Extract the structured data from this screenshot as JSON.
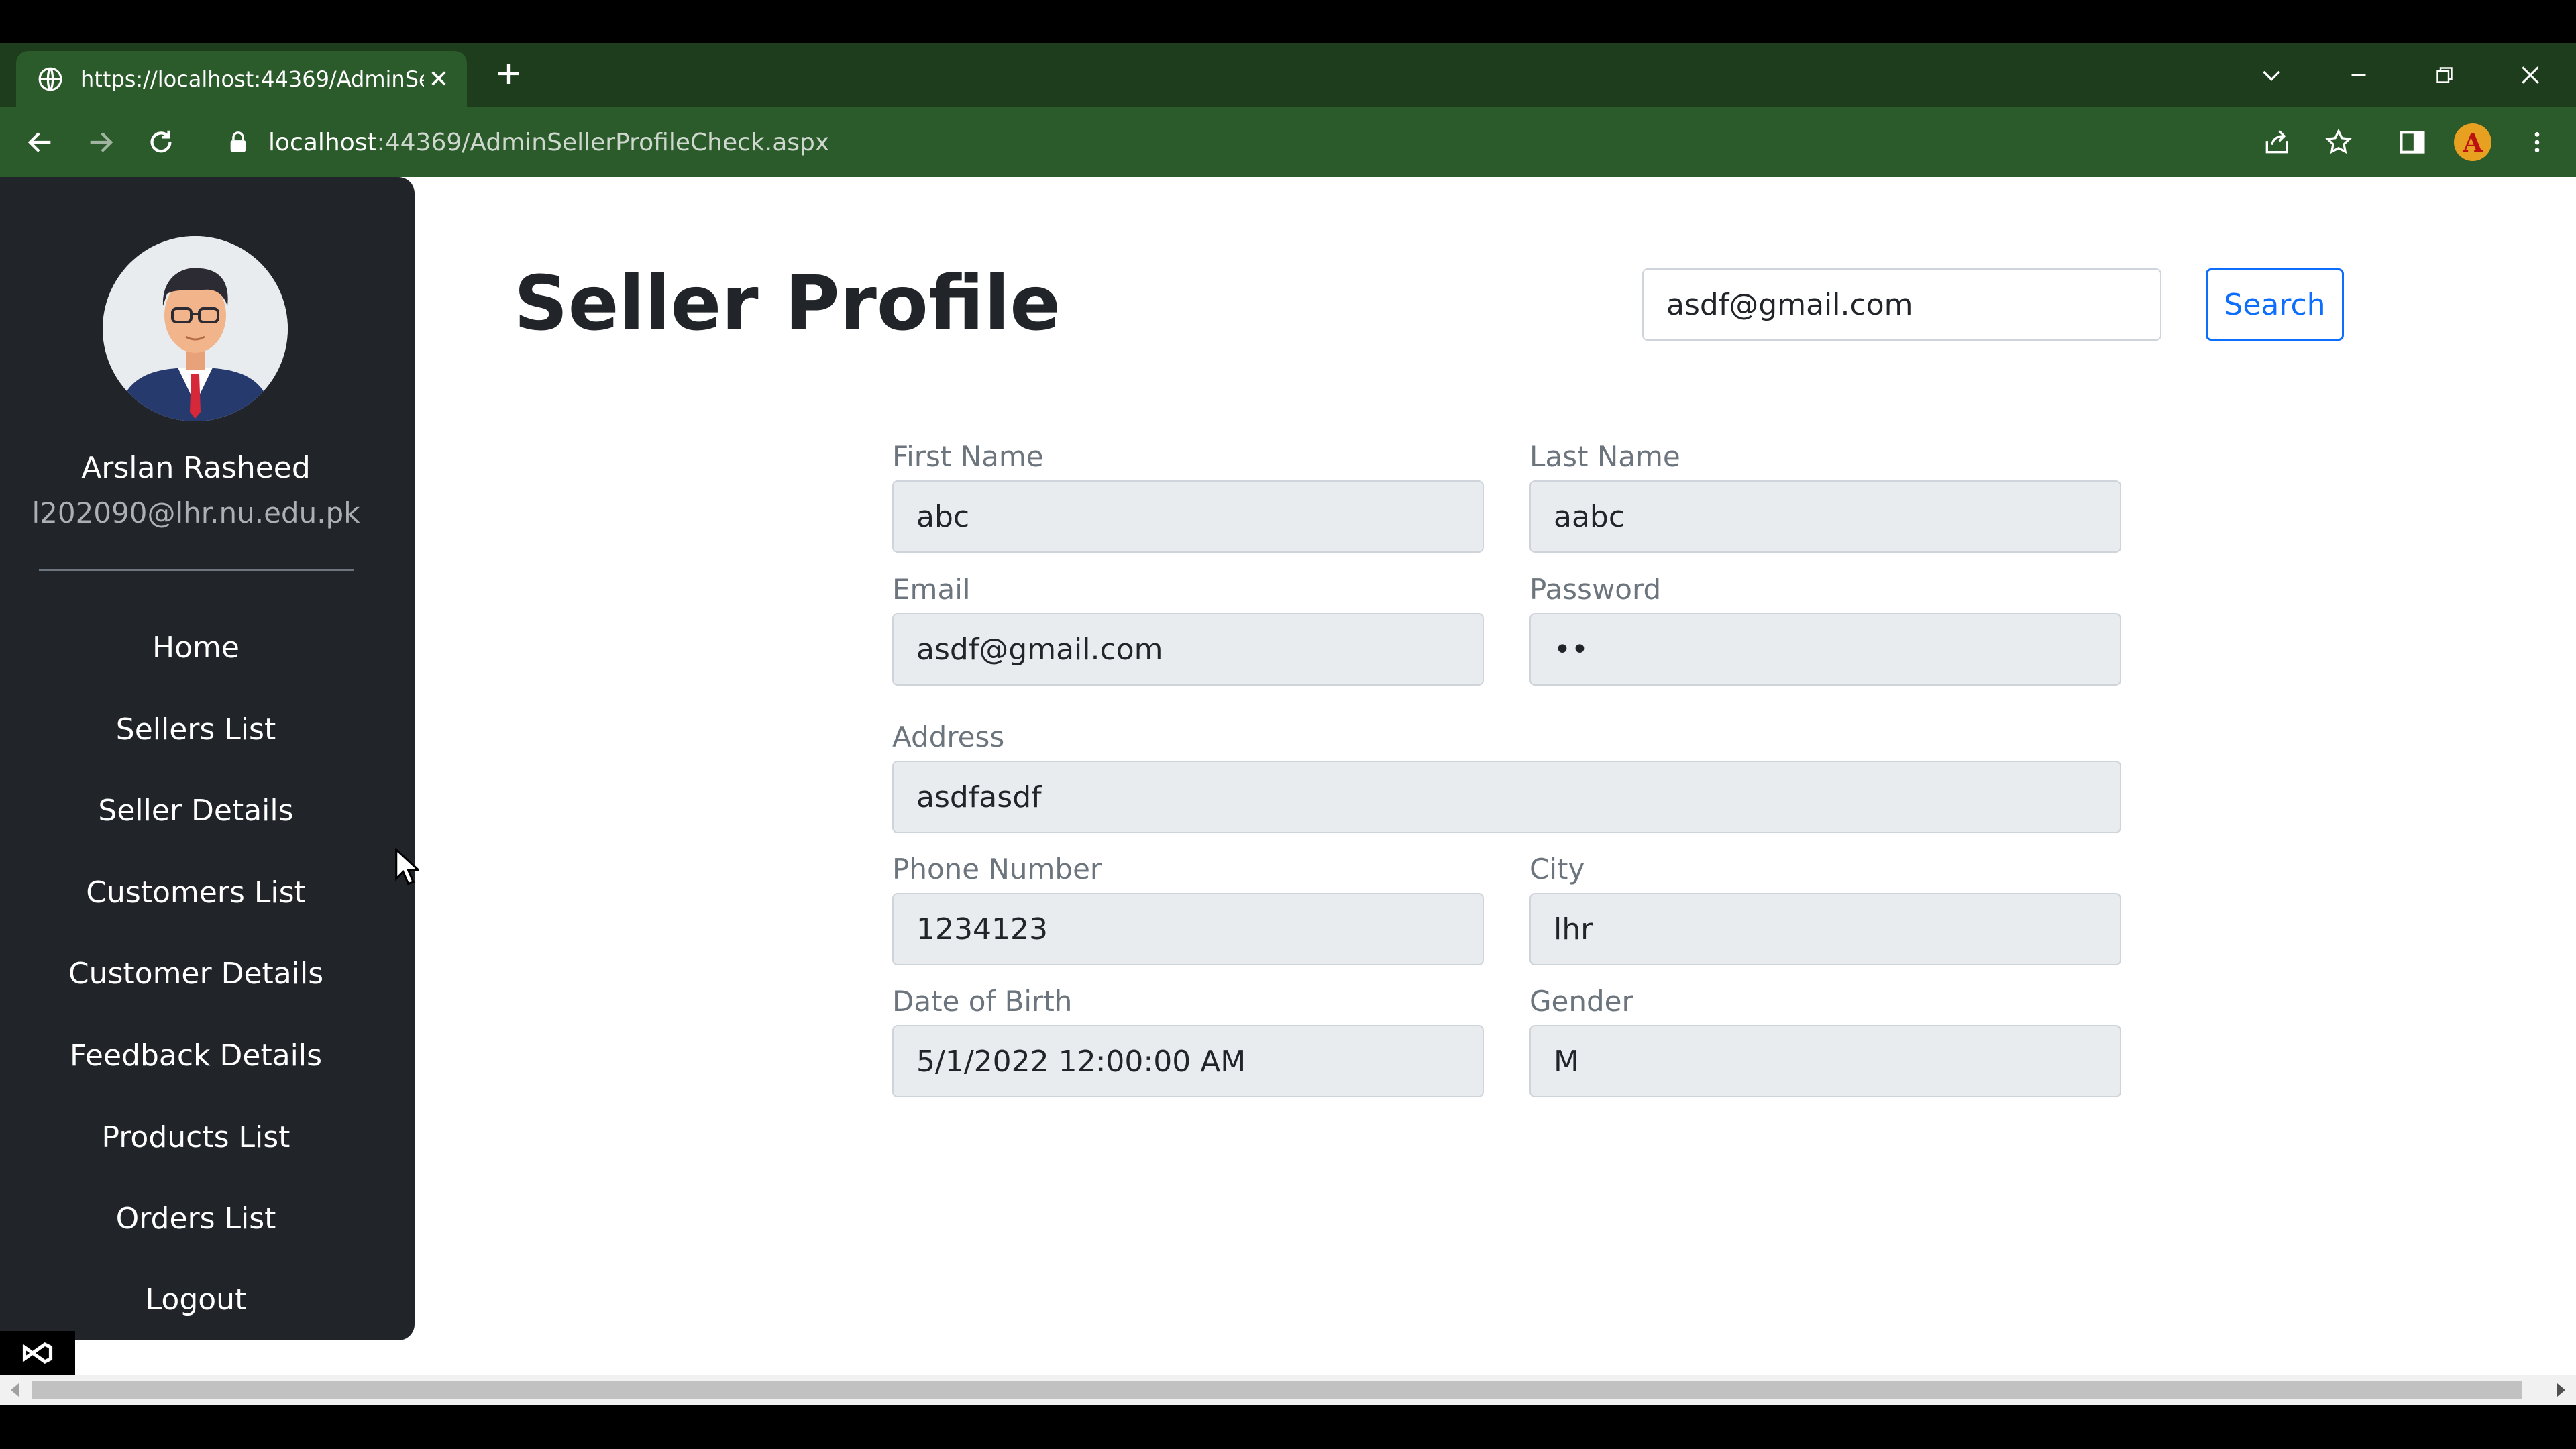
{
  "browser": {
    "tab_title": "https://localhost:44369/AdminSe",
    "url_host": "localhost",
    "url_rest": ":44369/AdminSellerProfileCheck.aspx",
    "profile_initial": "A"
  },
  "sidebar": {
    "user_name": "Arslan Rasheed",
    "user_email": "l202090@lhr.nu.edu.pk",
    "items": [
      {
        "label": "Home"
      },
      {
        "label": "Sellers List"
      },
      {
        "label": "Seller Details"
      },
      {
        "label": "Customers List"
      },
      {
        "label": "Customer Details"
      },
      {
        "label": "Feedback Details"
      },
      {
        "label": "Products List"
      },
      {
        "label": "Orders List"
      },
      {
        "label": "Logout"
      }
    ]
  },
  "main": {
    "title": "Seller Profile",
    "search_value": "asdf@gmail.com",
    "search_button": "Search"
  },
  "form": {
    "first_name": {
      "label": "First Name",
      "value": "abc"
    },
    "last_name": {
      "label": "Last Name",
      "value": "aabc"
    },
    "email": {
      "label": "Email",
      "value": "asdf@gmail.com"
    },
    "password": {
      "label": "Password",
      "value": "••"
    },
    "address": {
      "label": "Address",
      "value": "asdfasdf"
    },
    "phone": {
      "label": "Phone Number",
      "value": "1234123"
    },
    "city": {
      "label": "City",
      "value": "lhr"
    },
    "dob": {
      "label": "Date of Birth",
      "value": "5/1/2022 12:00:00 AM"
    },
    "gender": {
      "label": "Gender",
      "value": "M"
    }
  },
  "colors": {
    "browser_frame": "#2b5a2b",
    "sidebar_bg": "#212529",
    "primary": "#0d6efd",
    "readonly_field_bg": "#e9ecef"
  }
}
